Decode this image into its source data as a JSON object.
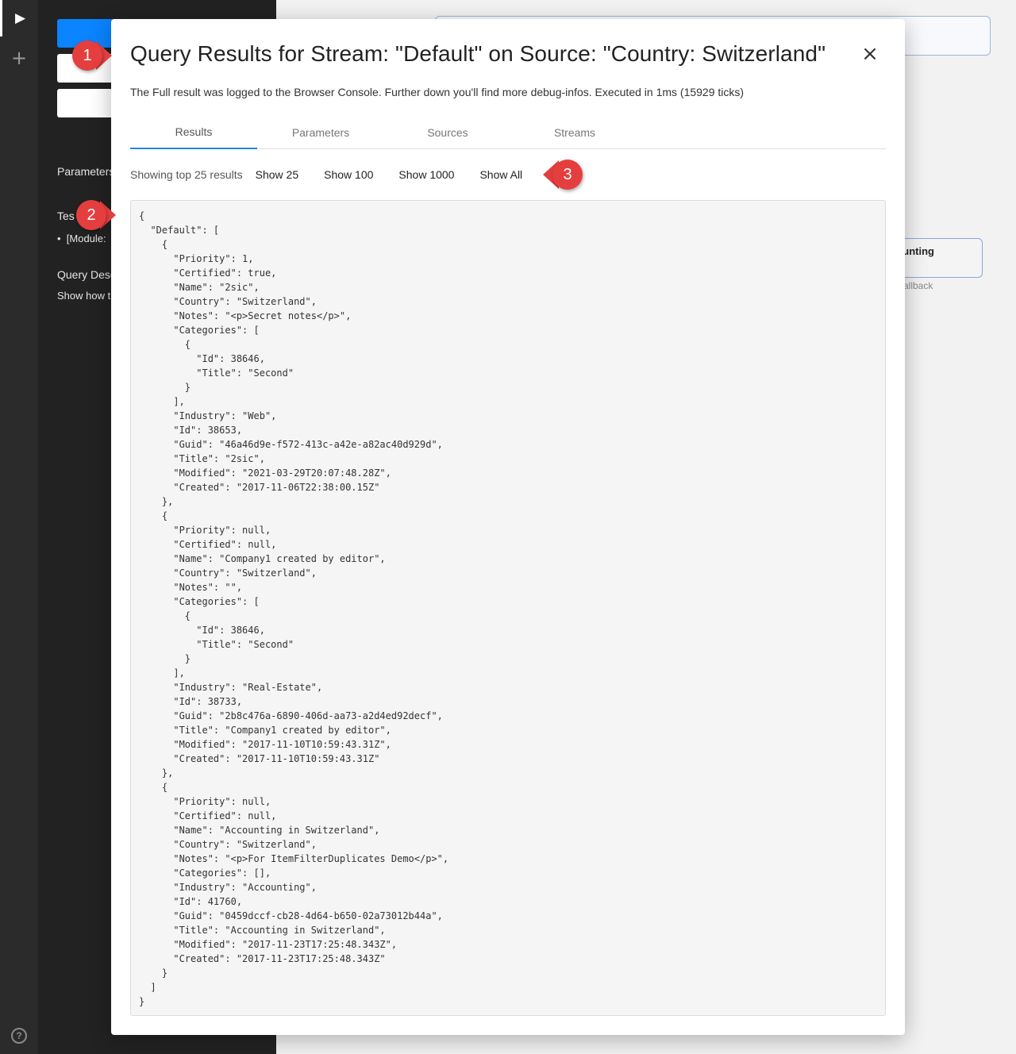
{
  "sidebar": {
    "parameters_label": "Parameters",
    "test_label": "Tes",
    "test_item": "[Module:",
    "query_desc_label": "Query Desc",
    "show_how_label": "Show how t"
  },
  "canvas": {
    "node_title": "unting",
    "node_caption": "allback"
  },
  "modal": {
    "title": "Query Results for Stream: \"Default\" on Source: \"Country: Switzerland\"",
    "subtitle": "The Full result was logged to the Browser Console. Further down you'll find more debug-infos. Executed in 1ms (15929 ticks)",
    "close_icon": "×",
    "tabs": [
      {
        "label": "Results"
      },
      {
        "label": "Parameters"
      },
      {
        "label": "Sources"
      },
      {
        "label": "Streams"
      }
    ],
    "showing_label": "Showing top 25 results",
    "show_buttons": [
      {
        "label": "Show 25"
      },
      {
        "label": "Show 100"
      },
      {
        "label": "Show 1000"
      },
      {
        "label": "Show All"
      }
    ],
    "result_json": "{\n  \"Default\": [\n    {\n      \"Priority\": 1,\n      \"Certified\": true,\n      \"Name\": \"2sic\",\n      \"Country\": \"Switzerland\",\n      \"Notes\": \"<p>Secret notes</p>\",\n      \"Categories\": [\n        {\n          \"Id\": 38646,\n          \"Title\": \"Second\"\n        }\n      ],\n      \"Industry\": \"Web\",\n      \"Id\": 38653,\n      \"Guid\": \"46a46d9e-f572-413c-a42e-a82ac40d929d\",\n      \"Title\": \"2sic\",\n      \"Modified\": \"2021-03-29T20:07:48.28Z\",\n      \"Created\": \"2017-11-06T22:38:00.15Z\"\n    },\n    {\n      \"Priority\": null,\n      \"Certified\": null,\n      \"Name\": \"Company1 created by editor\",\n      \"Country\": \"Switzerland\",\n      \"Notes\": \"\",\n      \"Categories\": [\n        {\n          \"Id\": 38646,\n          \"Title\": \"Second\"\n        }\n      ],\n      \"Industry\": \"Real-Estate\",\n      \"Id\": 38733,\n      \"Guid\": \"2b8c476a-6890-406d-aa73-a2d4ed92decf\",\n      \"Title\": \"Company1 created by editor\",\n      \"Modified\": \"2017-11-10T10:59:43.31Z\",\n      \"Created\": \"2017-11-10T10:59:43.31Z\"\n    },\n    {\n      \"Priority\": null,\n      \"Certified\": null,\n      \"Name\": \"Accounting in Switzerland\",\n      \"Country\": \"Switzerland\",\n      \"Notes\": \"<p>For ItemFilterDuplicates Demo</p>\",\n      \"Categories\": [],\n      \"Industry\": \"Accounting\",\n      \"Id\": 41760,\n      \"Guid\": \"0459dccf-cb28-4d64-b650-02a73012b44a\",\n      \"Title\": \"Accounting in Switzerland\",\n      \"Modified\": \"2017-11-23T17:25:48.343Z\",\n      \"Created\": \"2017-11-23T17:25:48.343Z\"\n    }\n  ]\n}"
  },
  "callouts": [
    {
      "label": "1"
    },
    {
      "label": "2"
    },
    {
      "label": "3"
    }
  ],
  "icons": {
    "play": "play-icon",
    "add": "plus-icon",
    "help": "help-circle-icon",
    "close": "close-icon"
  },
  "colors": {
    "accent": "#1e88e5",
    "primary_button": "#0a84ff",
    "callout": "#e53e3e"
  }
}
